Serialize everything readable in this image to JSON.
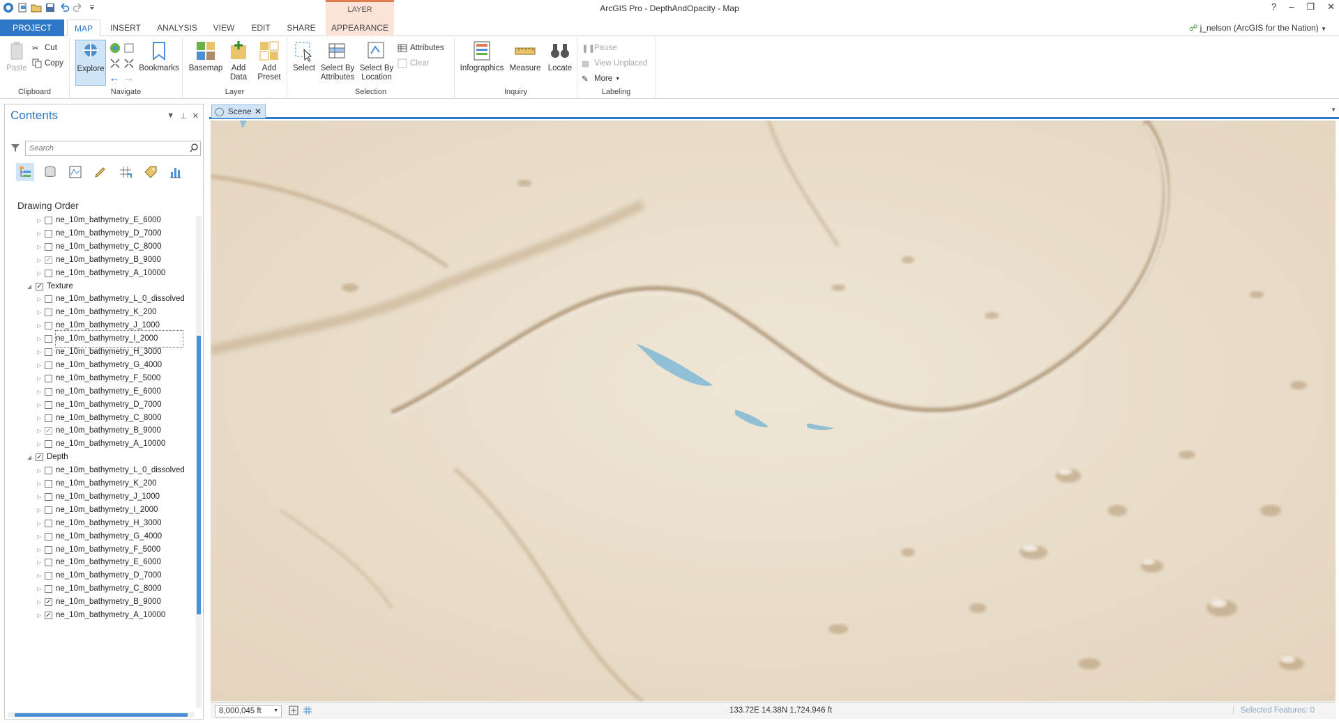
{
  "app": {
    "title": "ArcGIS Pro - DepthAndOpacity - Map",
    "context_tab_group": "LAYER"
  },
  "window_controls": {
    "help": "?",
    "minimize": "–",
    "restore": "❐",
    "close": "✕"
  },
  "tabs": [
    "PROJECT",
    "MAP",
    "INSERT",
    "ANALYSIS",
    "VIEW",
    "EDIT",
    "SHARE",
    "APPEARANCE"
  ],
  "active_tab": "MAP",
  "user": "j_nelson (ArcGIS for the Nation)",
  "ribbon": {
    "clipboard": {
      "label": "Clipboard",
      "paste": "Paste",
      "cut": "Cut",
      "copy": "Copy"
    },
    "navigate": {
      "label": "Navigate",
      "explore": "Explore",
      "bookmarks": "Bookmarks"
    },
    "layer": {
      "label": "Layer",
      "basemap": "Basemap",
      "add_data": "Add Data",
      "add_preset": "Add Preset"
    },
    "selection": {
      "label": "Selection",
      "select": "Select",
      "select_by_attributes": "Select By Attributes",
      "select_by_location": "Select By Location",
      "attributes": "Attributes",
      "clear": "Clear"
    },
    "inquiry": {
      "label": "Inquiry",
      "infographics": "Infographics",
      "measure": "Measure",
      "locate": "Locate"
    },
    "labeling": {
      "label": "Labeling",
      "pause": "Pause",
      "view_unplaced": "View Unplaced",
      "more": "More"
    }
  },
  "contents": {
    "title": "Contents",
    "search_placeholder": "Search",
    "drawing_order_label": "Drawing Order",
    "tree": [
      {
        "type": "layer",
        "label": "ne_10m_bathymetry_E_6000",
        "checked": false
      },
      {
        "type": "layer",
        "label": "ne_10m_bathymetry_D_7000",
        "checked": false
      },
      {
        "type": "layer",
        "label": "ne_10m_bathymetry_C_8000",
        "checked": false
      },
      {
        "type": "layer",
        "label": "ne_10m_bathymetry_B_9000",
        "checked": true,
        "dim": true
      },
      {
        "type": "layer",
        "label": "ne_10m_bathymetry_A_10000",
        "checked": false
      },
      {
        "type": "group",
        "label": "Texture",
        "checked": true
      },
      {
        "type": "layer",
        "label": "ne_10m_bathymetry_L_0_dissolved",
        "checked": false
      },
      {
        "type": "layer",
        "label": "ne_10m_bathymetry_K_200",
        "checked": false
      },
      {
        "type": "layer",
        "label": "ne_10m_bathymetry_J_1000",
        "checked": false
      },
      {
        "type": "layer",
        "label": "ne_10m_bathymetry_I_2000",
        "checked": false,
        "focus": true
      },
      {
        "type": "layer",
        "label": "ne_10m_bathymetry_H_3000",
        "checked": false
      },
      {
        "type": "layer",
        "label": "ne_10m_bathymetry_G_4000",
        "checked": false
      },
      {
        "type": "layer",
        "label": "ne_10m_bathymetry_F_5000",
        "checked": false
      },
      {
        "type": "layer",
        "label": "ne_10m_bathymetry_E_6000",
        "checked": false
      },
      {
        "type": "layer",
        "label": "ne_10m_bathymetry_D_7000",
        "checked": false
      },
      {
        "type": "layer",
        "label": "ne_10m_bathymetry_C_8000",
        "checked": false
      },
      {
        "type": "layer",
        "label": "ne_10m_bathymetry_B_9000",
        "checked": true,
        "dim": true
      },
      {
        "type": "layer",
        "label": "ne_10m_bathymetry_A_10000",
        "checked": false
      },
      {
        "type": "group",
        "label": "Depth",
        "checked": true
      },
      {
        "type": "layer",
        "label": "ne_10m_bathymetry_L_0_dissolved",
        "checked": false
      },
      {
        "type": "layer",
        "label": "ne_10m_bathymetry_K_200",
        "checked": false
      },
      {
        "type": "layer",
        "label": "ne_10m_bathymetry_J_1000",
        "checked": false
      },
      {
        "type": "layer",
        "label": "ne_10m_bathymetry_I_2000",
        "checked": false
      },
      {
        "type": "layer",
        "label": "ne_10m_bathymetry_H_3000",
        "checked": false
      },
      {
        "type": "layer",
        "label": "ne_10m_bathymetry_G_4000",
        "checked": false
      },
      {
        "type": "layer",
        "label": "ne_10m_bathymetry_F_5000",
        "checked": false
      },
      {
        "type": "layer",
        "label": "ne_10m_bathymetry_E_6000",
        "checked": false
      },
      {
        "type": "layer",
        "label": "ne_10m_bathymetry_D_7000",
        "checked": false
      },
      {
        "type": "layer",
        "label": "ne_10m_bathymetry_C_8000",
        "checked": false
      },
      {
        "type": "layer",
        "label": "ne_10m_bathymetry_B_9000",
        "checked": true
      },
      {
        "type": "layer",
        "label": "ne_10m_bathymetry_A_10000",
        "checked": true
      }
    ]
  },
  "view": {
    "tab_label": "Scene",
    "scale": "8,000,045 ft",
    "coordinates": "133.72E 14.38N   1,724.946 ft",
    "selected_features": "Selected Features: 0"
  },
  "colors": {
    "accent": "#2e78c7",
    "map_base": "#e8dcc8",
    "water": "#7fb8d6"
  }
}
